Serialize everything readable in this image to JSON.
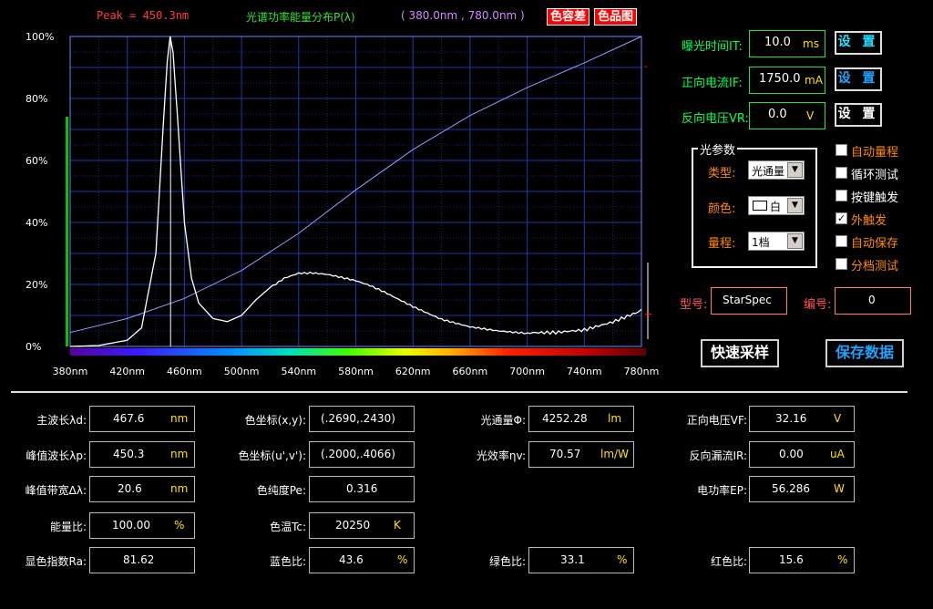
{
  "header": {
    "peak": "Peak = 450.3nm",
    "title": "光谱功率能量分布P(λ)",
    "range": "( 380.0nm , 780.0nm )",
    "btn_color_tolerance": "色容差",
    "btn_color_gamut": "色品图"
  },
  "chart_data": {
    "type": "line",
    "title": "光谱功率能量分布P(λ)",
    "xlabel": "",
    "ylabel": "",
    "xlim": [
      380,
      780
    ],
    "ylim": [
      0,
      100
    ],
    "x_ticks": [
      "380nm",
      "420nm",
      "460nm",
      "500nm",
      "540nm",
      "580nm",
      "620nm",
      "660nm",
      "700nm",
      "740nm",
      "780nm"
    ],
    "y_ticks": [
      "0%",
      "20%",
      "40%",
      "60%",
      "80%",
      "100%"
    ],
    "peak_marker": 450.3,
    "series": [
      {
        "x": [
          380,
          400,
          420,
          430,
          440,
          445,
          448,
          450,
          452,
          455,
          460,
          465,
          470,
          480,
          490,
          500,
          510,
          520,
          530,
          540,
          550,
          560,
          570,
          580,
          590,
          600,
          620,
          640,
          660,
          680,
          700,
          720,
          740,
          760,
          770,
          780
        ],
        "y": [
          0,
          0.3,
          2,
          6,
          30,
          70,
          92,
          100,
          95,
          75,
          40,
          22,
          14,
          9,
          8,
          10,
          15,
          19,
          22,
          23.5,
          23.5,
          23,
          22,
          21,
          19.5,
          17.5,
          13,
          9,
          6.5,
          5,
          4,
          4,
          5,
          8,
          10,
          12
        ]
      },
      {
        "x": [
          380,
          420,
          460,
          500,
          540,
          580,
          620,
          660,
          700,
          740,
          780
        ],
        "y": [
          4.5,
          9,
          15.5,
          24.5,
          36.5,
          50.5,
          63.5,
          74.5,
          83.5,
          91.5,
          100
        ]
      }
    ]
  },
  "controls": {
    "exposure_label": "曝光时间IT:",
    "exposure_value": "10.0",
    "exposure_unit": "ms",
    "current_label": "正向电流IF:",
    "current_value": "1750.0",
    "current_unit": "mA",
    "voltage_label": "反向电压VR:",
    "voltage_value": "0.0",
    "voltage_unit": "V",
    "set_label": "设 置"
  },
  "optical": {
    "group_title": "光参数",
    "type_label": "类型:",
    "type_value": "光通量",
    "color_label": "颜色:",
    "color_value": "白",
    "range_label": "量程:",
    "range_value": "1档"
  },
  "checkboxes": [
    {
      "label": "自动量程",
      "checked": false,
      "color": "#ff8a00"
    },
    {
      "label": "循环测试",
      "checked": false,
      "color": "#ffffff"
    },
    {
      "label": "按键触发",
      "checked": false,
      "color": "#ffffff"
    },
    {
      "label": "外触发",
      "checked": true,
      "color": "#ff8a00"
    },
    {
      "label": "自动保存",
      "checked": false,
      "color": "#ff8a00"
    },
    {
      "label": "分档测试",
      "checked": false,
      "color": "#ff8a00"
    }
  ],
  "model": {
    "model_label": "型号:",
    "model_value": "StarSpec",
    "number_label": "编号:",
    "number_value": "0"
  },
  "actions": {
    "quick_sample": "快速采样",
    "save_data": "保存数据"
  },
  "params": {
    "dominant_wl": {
      "label": "主波长λd:",
      "value": "467.6",
      "unit": "nm"
    },
    "peak_wl": {
      "label": "峰值波长λp:",
      "value": "450.3",
      "unit": "nm"
    },
    "peak_bw": {
      "label": "峰值带宽Δλ:",
      "value": "20.6",
      "unit": "nm"
    },
    "energy_ratio": {
      "label": "能量比:",
      "value": "100.00",
      "unit": "%"
    },
    "cri": {
      "label": "显色指数Ra:",
      "value": "81.62",
      "unit": ""
    },
    "xy": {
      "label": "色坐标(x,y):",
      "value": "(.2690,.2430)",
      "unit": ""
    },
    "uv": {
      "label": "色坐标(u',v'):",
      "value": "(.2000,.4066)",
      "unit": ""
    },
    "purity": {
      "label": "色纯度Pe:",
      "value": "0.316",
      "unit": ""
    },
    "cct": {
      "label": "色温Tc:",
      "value": "20250",
      "unit": "K"
    },
    "blue_ratio": {
      "label": "蓝色比:",
      "value": "43.6",
      "unit": "%"
    },
    "flux": {
      "label": "光通量Φ:",
      "value": "4252.28",
      "unit": "lm"
    },
    "efficacy": {
      "label": "光效率ηv:",
      "value": "70.57",
      "unit": "lm/W"
    },
    "green_ratio": {
      "label": "绿色比:",
      "value": "33.1",
      "unit": "%"
    },
    "vf": {
      "label": "正向电压VF:",
      "value": "32.16",
      "unit": "V"
    },
    "ir": {
      "label": "反向漏流IR:",
      "value": "0.00",
      "unit": "uA"
    },
    "power": {
      "label": "电功率EP:",
      "value": "56.286",
      "unit": "W"
    },
    "red_ratio": {
      "label": "红色比:",
      "value": "15.6",
      "unit": "%"
    }
  },
  "colors": {
    "grid": "#1c2f8c",
    "plot_border": "#6f85ff",
    "spectrum_line": "#ffffff",
    "reference_line": "#9a9dff",
    "label_green": "#00ff55",
    "label_orange": "#ff8a00",
    "button_blue": "#1fa3ff"
  }
}
